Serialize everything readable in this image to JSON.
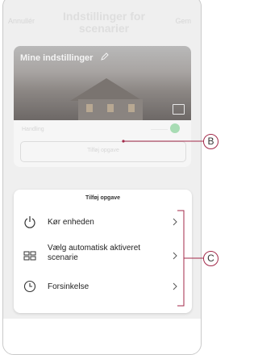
{
  "header": {
    "cancel_label": "Annullér",
    "title": "Indstillinger for scenarier",
    "save_label": "Gem"
  },
  "scene_card": {
    "name": "Mine indstillinger",
    "action_label": "Handling",
    "add_task_label": "Tilføj opgave"
  },
  "task_sheet": {
    "title": "Tilføj opgave",
    "options": [
      {
        "label": "Kør enheden",
        "icon": "power-icon"
      },
      {
        "label": "Vælg automatisk aktiveret scenarie",
        "icon": "scene-grid-icon"
      },
      {
        "label": "Forsinkelse",
        "icon": "clock-icon"
      }
    ]
  },
  "callouts": {
    "b": "B",
    "c": "C"
  },
  "colors": {
    "accent": "#a32a4a",
    "green": "#a8dcb4"
  }
}
